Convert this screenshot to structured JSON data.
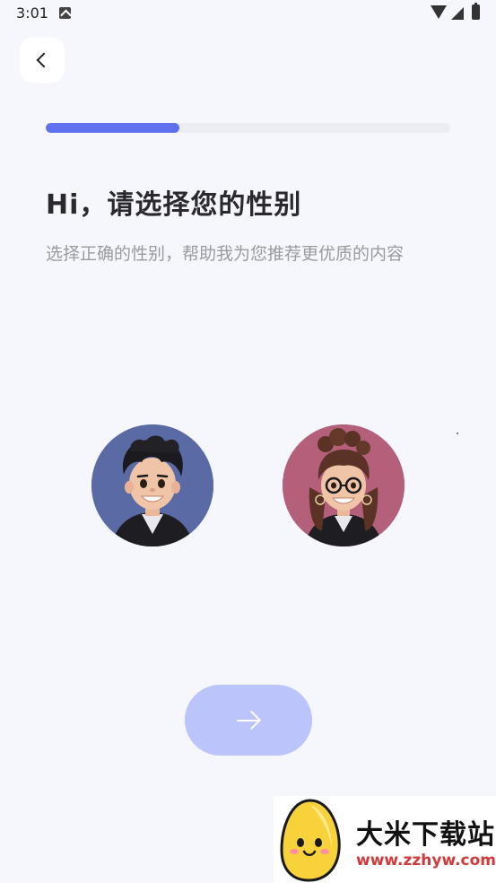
{
  "status_bar": {
    "time": "3:01",
    "icons": [
      "notification-icon",
      "wifi-icon",
      "signal-icon",
      "battery-icon"
    ]
  },
  "back_button": {
    "icon": "chevron-left-icon"
  },
  "progress": {
    "value_percent": 33,
    "fill_color": "#5f70f0",
    "track_color": "#ececf3"
  },
  "header": {
    "title": "Hi，请选择您的性别",
    "subtitle": "选择正确的性别，帮助我为您推荐更优质的内容"
  },
  "gender_options": [
    {
      "id": "male",
      "icon": "male-avatar",
      "bg_color": "#5a6aa5"
    },
    {
      "id": "female",
      "icon": "female-avatar",
      "bg_color": "#b5607a"
    }
  ],
  "next_button": {
    "icon": "arrow-right-icon",
    "color": "#bcc5fb"
  },
  "watermark": {
    "title": "大米下载站",
    "url": "www.zzhyw.com",
    "icon": "mascot-logo"
  },
  "colors": {
    "background": "#f6f7fd",
    "accent": "#5f70f0"
  }
}
